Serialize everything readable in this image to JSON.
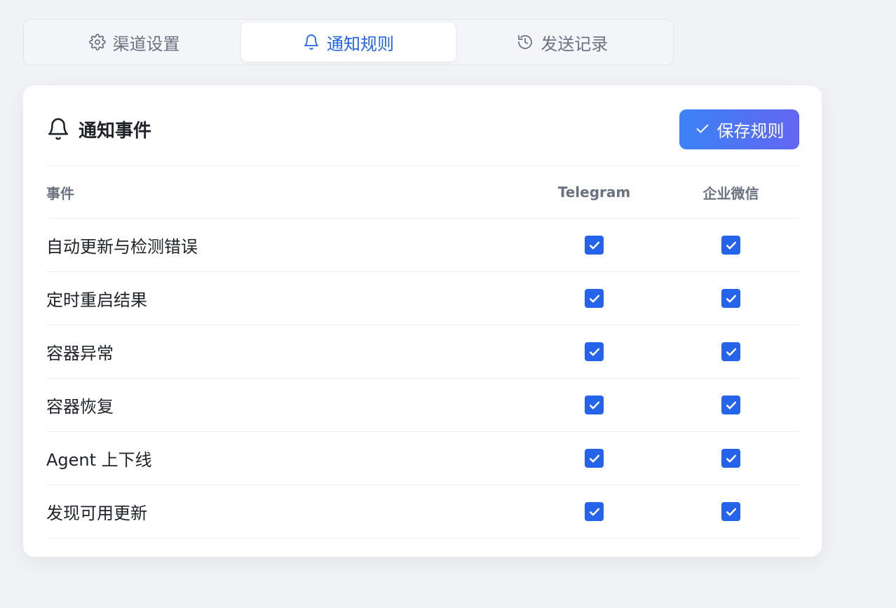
{
  "tabs": [
    {
      "label": "渠道设置",
      "icon": "gear-icon",
      "active": false
    },
    {
      "label": "通知规则",
      "icon": "bell-icon",
      "active": true
    },
    {
      "label": "发送记录",
      "icon": "history-icon",
      "active": false
    }
  ],
  "card": {
    "title": "通知事件",
    "title_icon": "bell-icon",
    "save_label": "保存规则"
  },
  "table": {
    "headers": {
      "event": "事件",
      "telegram": "Telegram",
      "wecom": "企业微信"
    },
    "rows": [
      {
        "event": "自动更新与检测错误",
        "telegram": true,
        "wecom": true
      },
      {
        "event": "定时重启结果",
        "telegram": true,
        "wecom": true
      },
      {
        "event": "容器异常",
        "telegram": true,
        "wecom": true
      },
      {
        "event": "容器恢复",
        "telegram": true,
        "wecom": true
      },
      {
        "event": "Agent 上下线",
        "telegram": true,
        "wecom": true
      },
      {
        "event": "发现可用更新",
        "telegram": true,
        "wecom": true
      }
    ]
  },
  "colors": {
    "accent": "#2563eb",
    "button_gradient_start": "#3b82f6",
    "button_gradient_end": "#6366f1"
  }
}
